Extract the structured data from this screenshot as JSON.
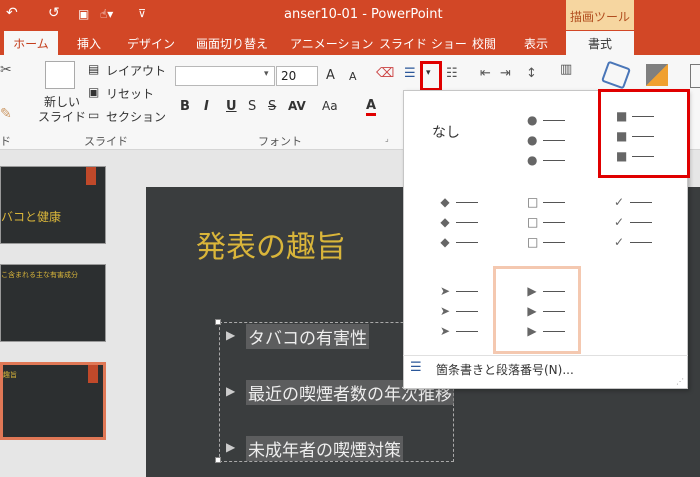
{
  "title_bar": {
    "doc_title": "anser10-01 - PowerPoint",
    "context_label": "描画ツール",
    "undo": "↶",
    "redo": "↺"
  },
  "tabs": [
    "ホーム",
    "挿入",
    "デザイン",
    "画面切り替え",
    "アニメーション",
    "スライド ショー",
    "校閲",
    "表示",
    "書式"
  ],
  "ribbon": {
    "new_slide": "新しい\nスライド",
    "layout": "レイアウト",
    "reset": "リセット",
    "section": "セクション",
    "slide_group": "スライド",
    "font_size": "20",
    "font_group": "フォント",
    "bold": "B",
    "italic": "I",
    "underline": "U",
    "strike": "S",
    "spacing": "AV",
    "case": "Aa",
    "font_color": "A"
  },
  "thumbnails": [
    {
      "title": "バコと健康"
    },
    {
      "title": "こ含まれる主な有害成分"
    },
    {
      "title": "趣旨"
    }
  ],
  "slide": {
    "title": "発表の趣旨",
    "bullets": [
      "タバコの有害性",
      "最近の喫煙者数の年次推移",
      "未成年者の喫煙対策"
    ]
  },
  "bullet_gallery": {
    "none_label": "なし",
    "footer_label": "箇条書きと段落番号(N)...",
    "options": [
      {
        "name": "none"
      },
      {
        "name": "filled-round"
      },
      {
        "name": "filled-square"
      },
      {
        "name": "diamond"
      },
      {
        "name": "hollow-square"
      },
      {
        "name": "check-mark"
      },
      {
        "name": "arrowhead"
      },
      {
        "name": "triangle"
      }
    ]
  },
  "colors": {
    "accent": "#d24726",
    "highlight": "#e00000",
    "selection": "#f4c8b0",
    "slide_title": "#d9b53a"
  }
}
